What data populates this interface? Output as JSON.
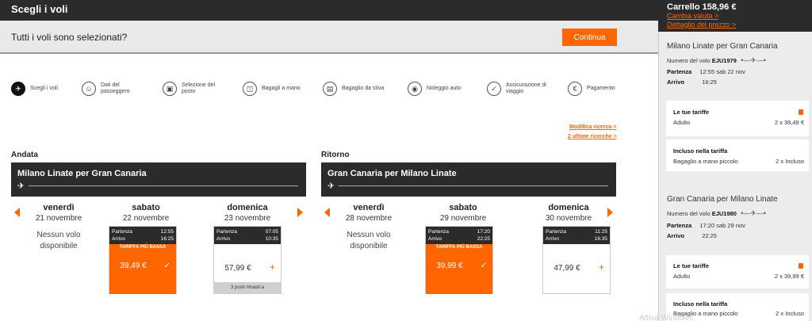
{
  "header": {
    "title": "Scegli i voli"
  },
  "banner": {
    "text": "Tutti i voli sono selezionati?",
    "continue_label": "Continua"
  },
  "steps": [
    {
      "label": "Scegli i voli",
      "icon": "airplane-icon"
    },
    {
      "label": "Dati del passeggero",
      "icon": "passenger-icon"
    },
    {
      "label": "Selezione del posto",
      "icon": "seat-icon"
    },
    {
      "label": "Bagagli a mano",
      "icon": "hand-bag-icon"
    },
    {
      "label": "Bagaglio da stiva",
      "icon": "hold-bag-icon"
    },
    {
      "label": "Noleggio auto",
      "icon": "car-icon"
    },
    {
      "label": "Assicurazione di viaggio",
      "icon": "shield-icon"
    },
    {
      "label": "Pagamento",
      "icon": "payment-icon"
    }
  ],
  "links": {
    "modify": "Modifica ricerca >",
    "last_searches": "2 ultime ricerche >"
  },
  "outbound": {
    "section": "Andata",
    "route": "Milano Linate per Gran Canaria",
    "days": [
      {
        "name": "venerdì",
        "date": "21 novembre",
        "status": "Nessun volo disponibile"
      },
      {
        "name": "sabato",
        "date": "22 novembre"
      },
      {
        "name": "domenica",
        "date": "23 novembre"
      }
    ],
    "cards": [
      {
        "dep_label": "Partenza",
        "dep": "12:55",
        "arr_label": "Arrivo",
        "arr": "16:25",
        "tag": "TARIFFA PIÙ BASSA",
        "price": "39,49 €",
        "mark": "✓"
      },
      {
        "dep_label": "Partenza",
        "dep": "07:05",
        "arr_label": "Arrivo",
        "arr": "10:35",
        "price": "57,99 €",
        "mark": "+",
        "seats": "3 posti rimasti a"
      }
    ]
  },
  "return": {
    "section": "Ritorno",
    "route": "Gran Canaria per Milano Linate",
    "days": [
      {
        "name": "venerdì",
        "date": "28 novembre",
        "status": "Nessun volo disponibile"
      },
      {
        "name": "sabato",
        "date": "29 novembre"
      },
      {
        "name": "domenica",
        "date": "30 novembre"
      }
    ],
    "cards": [
      {
        "dep_label": "Partenza",
        "dep": "17:20",
        "arr_label": "Arrivo",
        "arr": "22:25",
        "tag": "TARIFFA PIÙ BASSA",
        "price": "39,99 €",
        "mark": "✓"
      },
      {
        "dep_label": "Partenza",
        "dep": "11:25",
        "arr_label": "Arrivo",
        "arr": "16:35",
        "price": "47,99 €",
        "mark": "+"
      }
    ]
  },
  "sidebar": {
    "cart_total": "Carrello 158,96 €",
    "change_currency": "Cambia valuta >",
    "price_detail": "Dettaglio del prezzo >",
    "flights": [
      {
        "route": "Milano Linate per Gran Canaria",
        "flight_label": "Numero del volo",
        "flight_no": "EJU1979",
        "dep_label": "Partenza",
        "dep": "12:55 sab 22 nov",
        "arr_label": "Arrivo",
        "arr": "16:25",
        "fares_title": "Le tue tariffe",
        "fare_type": "Adulto",
        "fare_value": "2 x 39,49 €",
        "included_title": "Incluso nella tariffa",
        "included_item": "Bagaglio a mano piccolo",
        "included_value": "2 x Incluso"
      },
      {
        "route": "Gran Canaria per Milano Linate",
        "flight_label": "Numero del volo",
        "flight_no": "EJU1980",
        "dep_label": "Partenza",
        "dep": "17:20 sab 29 nov",
        "arr_label": "Arrivo",
        "arr": "22:25",
        "fares_title": "Le tue tariffe",
        "fare_type": "Adulto",
        "fare_value": "2 x 39,99 €",
        "included_title": "Incluso nella tariffa",
        "included_item": "Bagaglio a mano piccolo",
        "included_value": "2 x Incluso"
      }
    ]
  },
  "watermark": "Attiva Windows",
  "colors": {
    "accent": "#ff6600",
    "dark": "#2b2b2b"
  }
}
